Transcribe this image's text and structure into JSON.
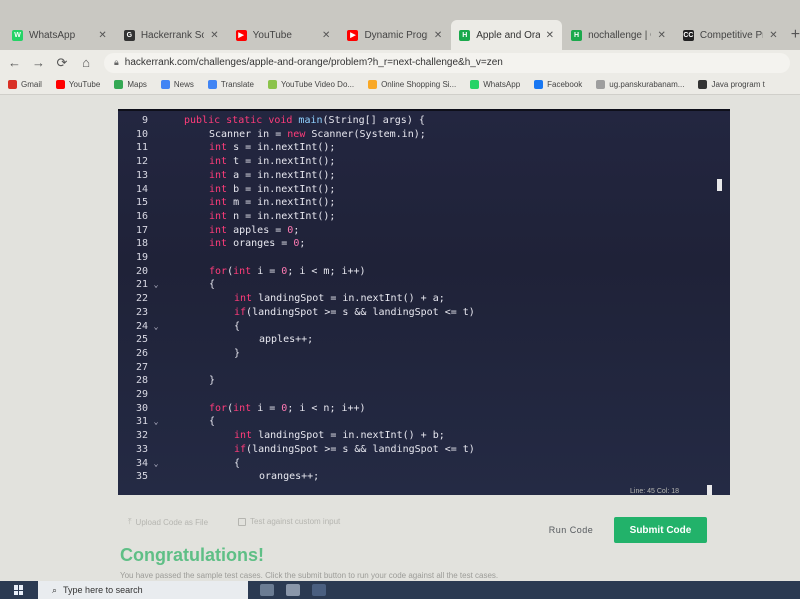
{
  "tabs": [
    {
      "title": "WhatsApp",
      "color": "#25d366",
      "glyph": "W"
    },
    {
      "title": "Hackerrank Solutio",
      "color": "#333333",
      "glyph": "G"
    },
    {
      "title": "YouTube",
      "color": "#ff0000",
      "glyph": "▶"
    },
    {
      "title": "Dynamic Programm",
      "color": "#ff0000",
      "glyph": "▶"
    },
    {
      "title": "Apple and Orange",
      "color": "#1ba94c",
      "glyph": "H",
      "active": true
    },
    {
      "title": "nochallenge | Cont",
      "color": "#1ba94c",
      "glyph": "H"
    },
    {
      "title": "Competitive Progr",
      "color": "#222222",
      "glyph": "CC"
    }
  ],
  "toolbar": {
    "url": "hackerrank.com/challenges/apple-and-orange/problem?h_r=next-challenge&h_v=zen"
  },
  "bookmarks": [
    {
      "label": "Gmail",
      "color": "#d93025"
    },
    {
      "label": "YouTube",
      "color": "#ff0000"
    },
    {
      "label": "Maps",
      "color": "#34a853"
    },
    {
      "label": "News",
      "color": "#4285f4"
    },
    {
      "label": "Translate",
      "color": "#4285f4"
    },
    {
      "label": "YouTube Video Do...",
      "color": "#8bc34a"
    },
    {
      "label": "Online Shopping Si...",
      "color": "#f9a825"
    },
    {
      "label": "WhatsApp",
      "color": "#25d366"
    },
    {
      "label": "Facebook",
      "color": "#1877f2"
    },
    {
      "label": "ug.panskurabanam...",
      "color": "#9e9e9e"
    },
    {
      "label": "Java program t",
      "color": "#333333"
    }
  ],
  "editor": {
    "lines": [
      {
        "n": "9",
        "fold": "",
        "indent": 1,
        "tokens": [
          [
            "kw",
            "public "
          ],
          [
            "kw",
            "static "
          ],
          [
            "kw",
            "void "
          ],
          [
            "fn",
            "main"
          ],
          [
            "p",
            "("
          ],
          [
            "p",
            "String[] args) {"
          ]
        ]
      },
      {
        "n": "10",
        "fold": "",
        "indent": 2,
        "tokens": [
          [
            "p",
            "Scanner in = "
          ],
          [
            "kw",
            "new "
          ],
          [
            "p",
            "Scanner(System.in);"
          ]
        ]
      },
      {
        "n": "11",
        "fold": "",
        "indent": 2,
        "tokens": [
          [
            "ty",
            "int "
          ],
          [
            "p",
            "s = in.nextInt();"
          ]
        ]
      },
      {
        "n": "12",
        "fold": "",
        "indent": 2,
        "tokens": [
          [
            "ty",
            "int "
          ],
          [
            "p",
            "t = in.nextInt();"
          ]
        ]
      },
      {
        "n": "13",
        "fold": "",
        "indent": 2,
        "tokens": [
          [
            "ty",
            "int "
          ],
          [
            "p",
            "a = in.nextInt();"
          ]
        ]
      },
      {
        "n": "14",
        "fold": "",
        "indent": 2,
        "tokens": [
          [
            "ty",
            "int "
          ],
          [
            "p",
            "b = in.nextInt();"
          ]
        ]
      },
      {
        "n": "15",
        "fold": "",
        "indent": 2,
        "tokens": [
          [
            "ty",
            "int "
          ],
          [
            "p",
            "m = in.nextInt();"
          ]
        ]
      },
      {
        "n": "16",
        "fold": "",
        "indent": 2,
        "tokens": [
          [
            "ty",
            "int "
          ],
          [
            "p",
            "n = in.nextInt();"
          ]
        ]
      },
      {
        "n": "17",
        "fold": "",
        "indent": 2,
        "tokens": [
          [
            "ty",
            "int "
          ],
          [
            "p",
            "apples = "
          ],
          [
            "num",
            "0"
          ],
          [
            "p",
            ";"
          ]
        ]
      },
      {
        "n": "18",
        "fold": "",
        "indent": 2,
        "tokens": [
          [
            "ty",
            "int "
          ],
          [
            "p",
            "oranges = "
          ],
          [
            "num",
            "0"
          ],
          [
            "p",
            ";"
          ]
        ]
      },
      {
        "n": "19",
        "fold": "",
        "indent": 0,
        "tokens": []
      },
      {
        "n": "20",
        "fold": "",
        "indent": 2,
        "tokens": [
          [
            "kw",
            "for"
          ],
          [
            "p",
            "("
          ],
          [
            "ty",
            "int "
          ],
          [
            "p",
            "i = "
          ],
          [
            "num",
            "0"
          ],
          [
            "p",
            "; i < m; i++)"
          ]
        ]
      },
      {
        "n": "21",
        "fold": "⌄",
        "indent": 2,
        "tokens": [
          [
            "p",
            "{"
          ]
        ]
      },
      {
        "n": "22",
        "fold": "",
        "indent": 3,
        "tokens": [
          [
            "ty",
            "int "
          ],
          [
            "p",
            "landingSpot = in.nextInt() + a;"
          ]
        ]
      },
      {
        "n": "23",
        "fold": "",
        "indent": 3,
        "tokens": [
          [
            "kw",
            "if"
          ],
          [
            "p",
            "(landingSpot >= s && landingSpot <= t)"
          ]
        ]
      },
      {
        "n": "24",
        "fold": "⌄",
        "indent": 3,
        "tokens": [
          [
            "p",
            "{"
          ]
        ]
      },
      {
        "n": "25",
        "fold": "",
        "indent": 4,
        "tokens": [
          [
            "p",
            "apples++;"
          ]
        ]
      },
      {
        "n": "26",
        "fold": "",
        "indent": 3,
        "tokens": [
          [
            "p",
            "}"
          ]
        ]
      },
      {
        "n": "27",
        "fold": "",
        "indent": 0,
        "tokens": []
      },
      {
        "n": "28",
        "fold": "",
        "indent": 2,
        "tokens": [
          [
            "p",
            "}"
          ]
        ]
      },
      {
        "n": "29",
        "fold": "",
        "indent": 0,
        "tokens": []
      },
      {
        "n": "30",
        "fold": "",
        "indent": 2,
        "tokens": [
          [
            "kw",
            "for"
          ],
          [
            "p",
            "("
          ],
          [
            "ty",
            "int "
          ],
          [
            "p",
            "i = "
          ],
          [
            "num",
            "0"
          ],
          [
            "p",
            "; i < n; i++)"
          ]
        ]
      },
      {
        "n": "31",
        "fold": "⌄",
        "indent": 2,
        "tokens": [
          [
            "p",
            "{"
          ]
        ]
      },
      {
        "n": "32",
        "fold": "",
        "indent": 3,
        "tokens": [
          [
            "ty",
            "int "
          ],
          [
            "p",
            "landingSpot = in.nextInt() + b;"
          ]
        ]
      },
      {
        "n": "33",
        "fold": "",
        "indent": 3,
        "tokens": [
          [
            "kw",
            "if"
          ],
          [
            "p",
            "(landingSpot >= s && landingSpot <= t)"
          ]
        ]
      },
      {
        "n": "34",
        "fold": "⌄",
        "indent": 3,
        "tokens": [
          [
            "p",
            "{"
          ]
        ]
      },
      {
        "n": "35",
        "fold": "",
        "indent": 4,
        "tokens": [
          [
            "p",
            "oranges++;"
          ]
        ]
      }
    ],
    "status": "Line: 45 Col: 18"
  },
  "actions": {
    "upload": "Upload Code as File",
    "test_custom": "Test against custom input",
    "run": "Run Code",
    "submit": "Submit Code"
  },
  "result": {
    "title": "Congratulations!",
    "message": "You have passed the sample test cases. Click the submit button to run your code against all the test cases."
  },
  "taskbar": {
    "search_placeholder": "Type here to search"
  }
}
